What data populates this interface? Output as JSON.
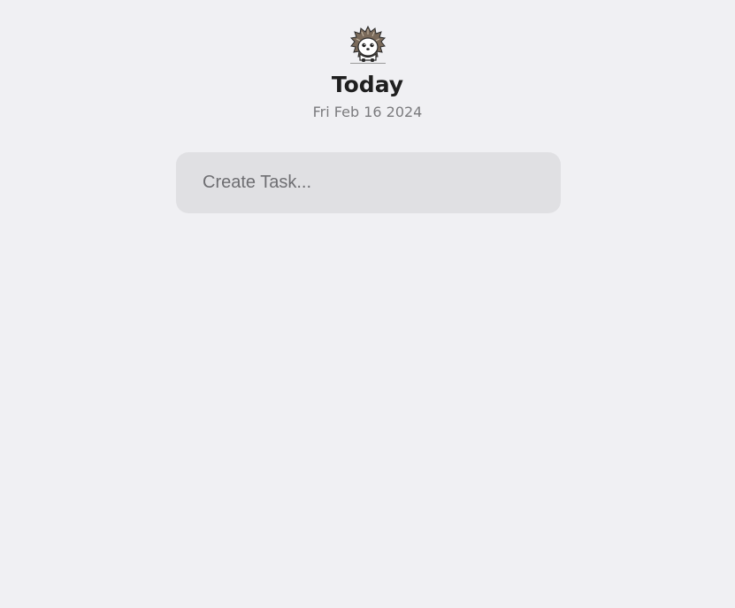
{
  "app": {
    "logo_icon": "hedgehog-icon"
  },
  "header": {
    "title": "Today",
    "date": "Fri Feb 16 2024"
  },
  "create_task": {
    "placeholder": "Create Task...",
    "value": ""
  },
  "colors": {
    "background": "#f0f0f3",
    "input_background": "#e0e0e3",
    "title": "#1f1f1f",
    "date": "#7b7b7e"
  }
}
